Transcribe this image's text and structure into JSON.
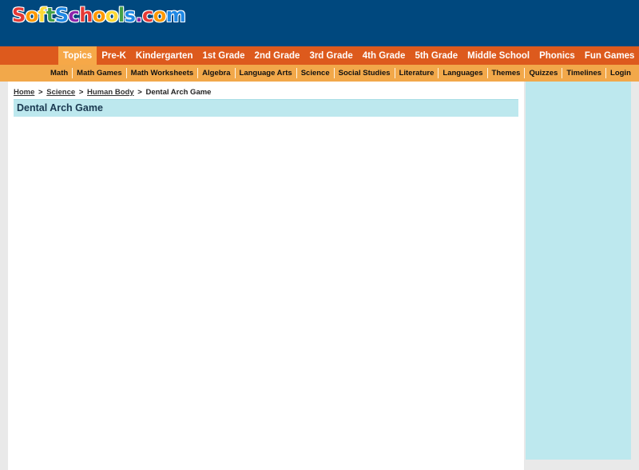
{
  "logo": {
    "text": "SoftSchools.com",
    "letter_colors": [
      "#e53935",
      "#ff9800",
      "#fdd835",
      "#43a047",
      "#1e88e5",
      "#8e24aa",
      "#e53935",
      "#ff9800",
      "#fdd835",
      "#43a047",
      "#1e88e5",
      "#8e24aa",
      "#e53935",
      "#ff9800",
      "#1e88e5"
    ]
  },
  "colors": {
    "header": "#00487e",
    "nav_primary": "#dd5a1d",
    "nav_secondary": "#f2a84a",
    "accent_panel": "#bde8ee"
  },
  "nav_primary": [
    {
      "label": "Topics",
      "active": true
    },
    {
      "label": "Pre-K"
    },
    {
      "label": "Kindergarten"
    },
    {
      "label": "1st Grade"
    },
    {
      "label": "2nd Grade"
    },
    {
      "label": "3rd Grade"
    },
    {
      "label": "4th Grade"
    },
    {
      "label": "5th Grade"
    },
    {
      "label": "Middle School"
    },
    {
      "label": "Phonics"
    },
    {
      "label": "Fun Games"
    }
  ],
  "nav_secondary": [
    {
      "label": "Math"
    },
    {
      "label": "Math Games"
    },
    {
      "label": "Math Worksheets"
    },
    {
      "label": "Algebra"
    },
    {
      "label": "Language Arts"
    },
    {
      "label": "Science"
    },
    {
      "label": "Social Studies"
    },
    {
      "label": "Literature"
    },
    {
      "label": "Languages"
    },
    {
      "label": "Themes"
    },
    {
      "label": "Quizzes"
    },
    {
      "label": "Timelines"
    },
    {
      "label": "Login"
    }
  ],
  "breadcrumb": {
    "home": "Home",
    "science": "Science",
    "human_body": "Human Body",
    "separator": ">",
    "current": "Dental Arch Game"
  },
  "page_title": "Dental Arch Game"
}
